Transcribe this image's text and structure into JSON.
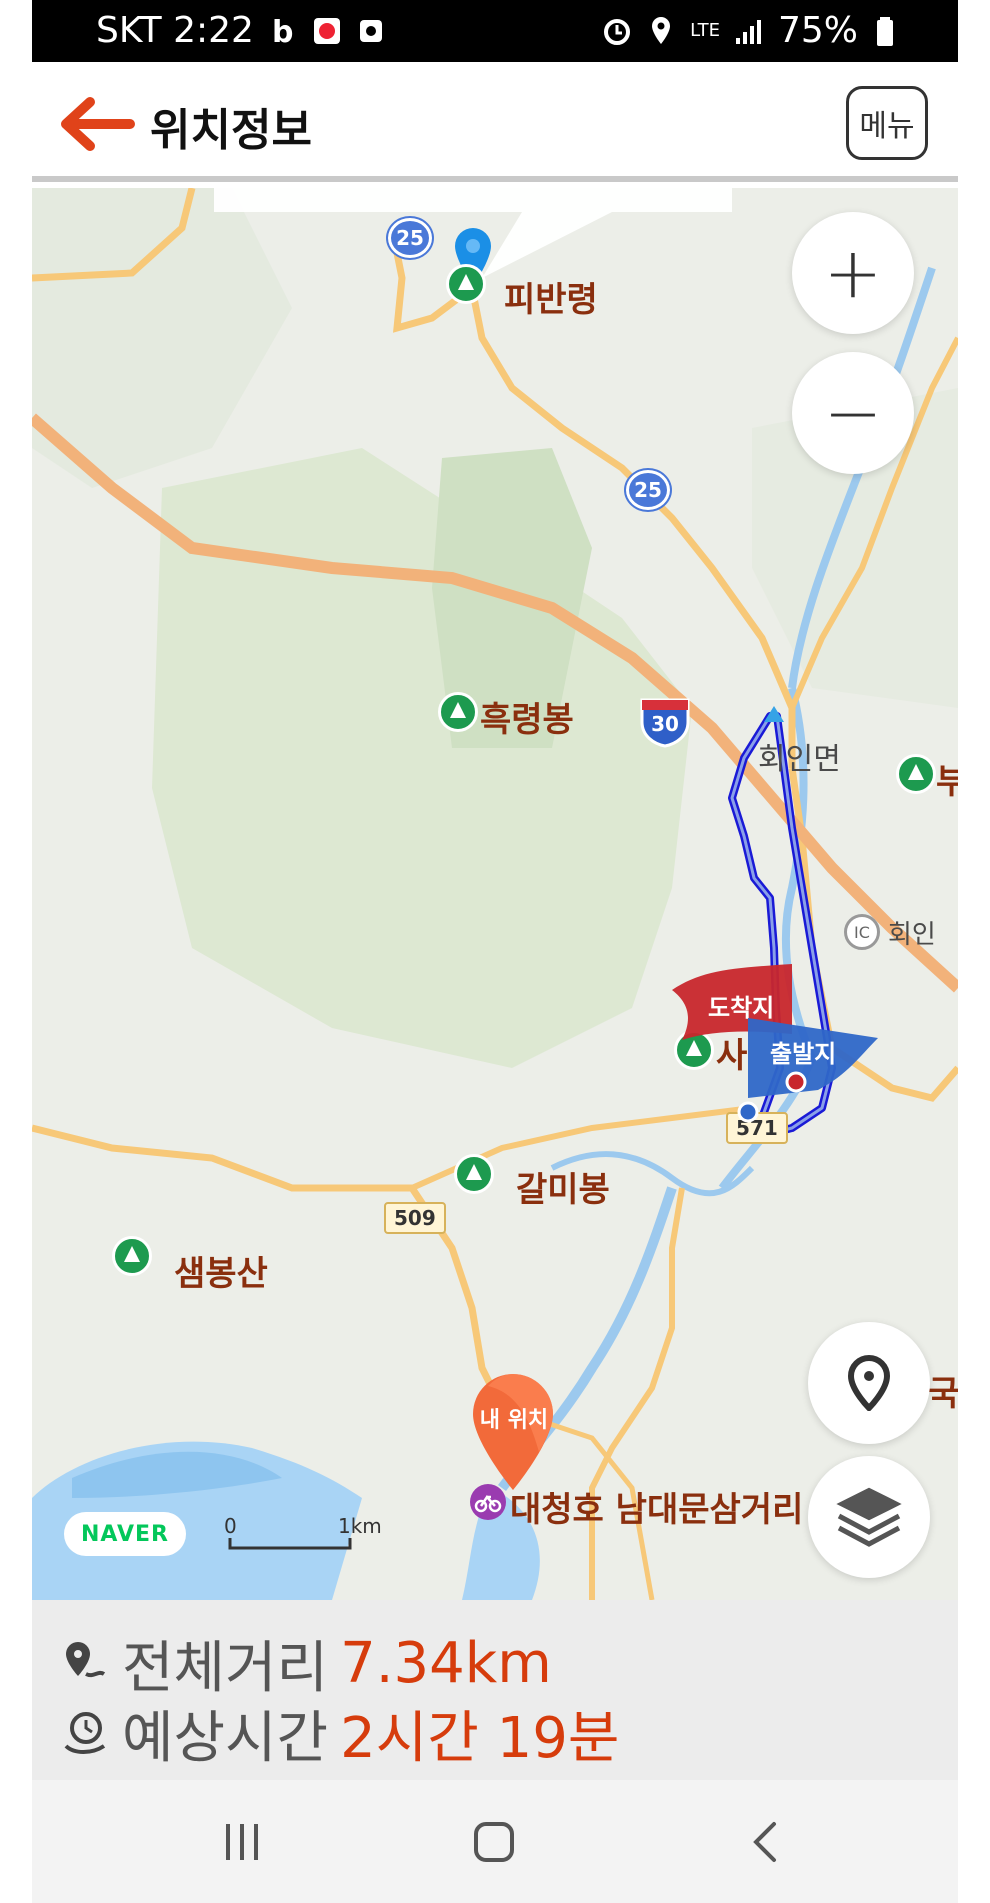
{
  "status_bar": {
    "carrier_time": "SKT 2:22",
    "battery": "75%",
    "network": "LTE"
  },
  "header": {
    "title": "위치정보",
    "menu_label": "메뉴"
  },
  "map": {
    "places": {
      "peak_pibanryeong": "피반령",
      "peak_heukryeongbong": "흑령봉",
      "town_hoein": "회인면",
      "peak_galmibong": "갈미봉",
      "peak_saembongsan": "샘봉산",
      "peak_sa": "사",
      "ic_hoein": "회인",
      "poi_daecheongho": "대청호 남대문삼거리",
      "partial_bu": "부",
      "partial_guk": "국"
    },
    "route_numbers": {
      "r25_top": "25",
      "r25_mid": "25",
      "hwy30": "30",
      "r509": "509",
      "r571": "571"
    },
    "ic_badge": "IC",
    "flags": {
      "arrival": "도착지",
      "departure": "출발지"
    },
    "my_location_label": "내 위치",
    "brand": "NAVER",
    "scale": {
      "zero": "0",
      "unit": "1km"
    },
    "zoom_in": "+",
    "zoom_out": "−"
  },
  "summary": {
    "distance_label": "전체거리",
    "distance_value": "7.34km",
    "time_label": "예상시간",
    "time_value": "2시간 19분"
  },
  "colors": {
    "accent": "#d63c0c",
    "route": "#1a1ad6",
    "water": "#a9d4f5",
    "road": "#f7c878",
    "forest": "#d9e6cf"
  },
  "icons": [
    "back-arrow-icon",
    "menu-button",
    "zoom-in-icon",
    "zoom-out-icon",
    "location-pin-icon",
    "layers-icon",
    "distance-icon",
    "time-icon",
    "recent-apps-icon",
    "home-icon",
    "back-icon"
  ]
}
